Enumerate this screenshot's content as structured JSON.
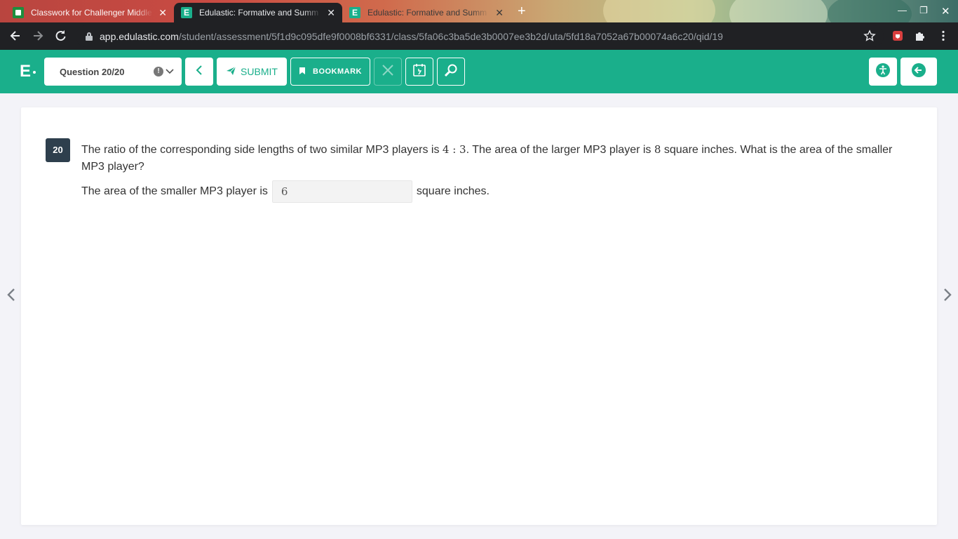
{
  "browser": {
    "tabs": [
      {
        "title": "Classwork for Challenger Middle",
        "favicon": "google-classroom-icon",
        "active": false
      },
      {
        "title": "Edulastic: Formative and Summ",
        "favicon": "edulastic-icon",
        "active": true
      },
      {
        "title": "Edulastic: Formative and Summ",
        "favicon": "edulastic-icon",
        "active": false
      }
    ],
    "url_host": "app.edulastic.com",
    "url_path": "/student/assessment/5f1d9c095dfe9f0008bf6331/class/5fa06c3ba5de3b0007ee3b2d/uta/5fd18a7052a67b00074a6c20/qid/19"
  },
  "header": {
    "logo_letter": "E",
    "question_selector": "Question 20/20",
    "submit_label": "SUBMIT",
    "bookmark_label": "BOOKMARK",
    "accent_color": "#1aaf8b"
  },
  "question": {
    "number": "20",
    "text_part1": "The ratio of the corresponding side lengths of two similar MP3 players is ",
    "ratio": "4 : 3",
    "text_part2": ".  The area of the larger MP3 player is ",
    "area_larger": "8",
    "text_part3": " square inches.  What is the area of the smaller MP3 player?",
    "answer_prefix": "The area of the smaller MP3 player is",
    "answer_value": "6",
    "answer_suffix": "square inches."
  }
}
